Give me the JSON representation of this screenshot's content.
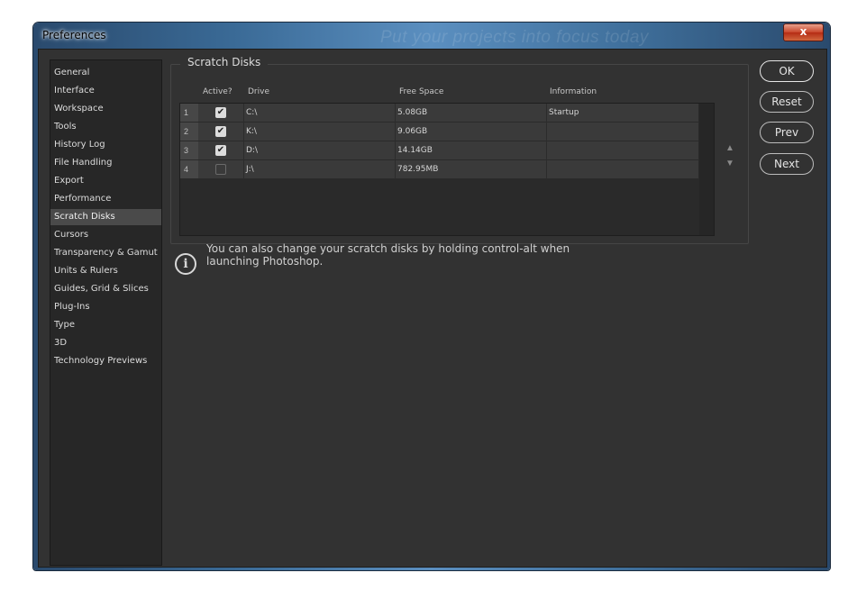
{
  "window": {
    "title": "Preferences",
    "title_bg_text": "Put your projects into focus today",
    "close_label": "x"
  },
  "sidebar": {
    "items": [
      {
        "label": "General"
      },
      {
        "label": "Interface"
      },
      {
        "label": "Workspace"
      },
      {
        "label": "Tools"
      },
      {
        "label": "History Log"
      },
      {
        "label": "File Handling"
      },
      {
        "label": "Export"
      },
      {
        "label": "Performance"
      },
      {
        "label": "Scratch Disks",
        "selected": true
      },
      {
        "label": "Cursors"
      },
      {
        "label": "Transparency & Gamut"
      },
      {
        "label": "Units & Rulers"
      },
      {
        "label": "Guides, Grid & Slices"
      },
      {
        "label": "Plug-Ins"
      },
      {
        "label": "Type"
      },
      {
        "label": "3D"
      },
      {
        "label": "Technology Previews"
      }
    ]
  },
  "scratch_disks": {
    "title": "Scratch Disks",
    "headers": {
      "active": "Active?",
      "drive": "Drive",
      "free_space": "Free Space",
      "information": "Information"
    },
    "rows": [
      {
        "num": "1",
        "active": true,
        "drive": "C:\\",
        "free_space": "5.08GB",
        "information": "Startup"
      },
      {
        "num": "2",
        "active": true,
        "drive": "K:\\",
        "free_space": "9.06GB",
        "information": ""
      },
      {
        "num": "3",
        "active": true,
        "drive": "D:\\",
        "free_space": "14.14GB",
        "information": ""
      },
      {
        "num": "4",
        "active": false,
        "drive": "J:\\",
        "free_space": "782.95MB",
        "information": ""
      }
    ],
    "move_up_icon": "▲",
    "move_down_icon": "▼"
  },
  "info": {
    "icon": "i",
    "text": "You can also change your scratch disks by holding control-alt when launching Photoshop."
  },
  "buttons": {
    "ok": "OK",
    "reset": "Reset",
    "prev": "Prev",
    "next": "Next"
  },
  "colors": {
    "panel_bg": "#323232",
    "sidebar_bg": "#272727",
    "selected_bg": "#4a4a4a"
  }
}
